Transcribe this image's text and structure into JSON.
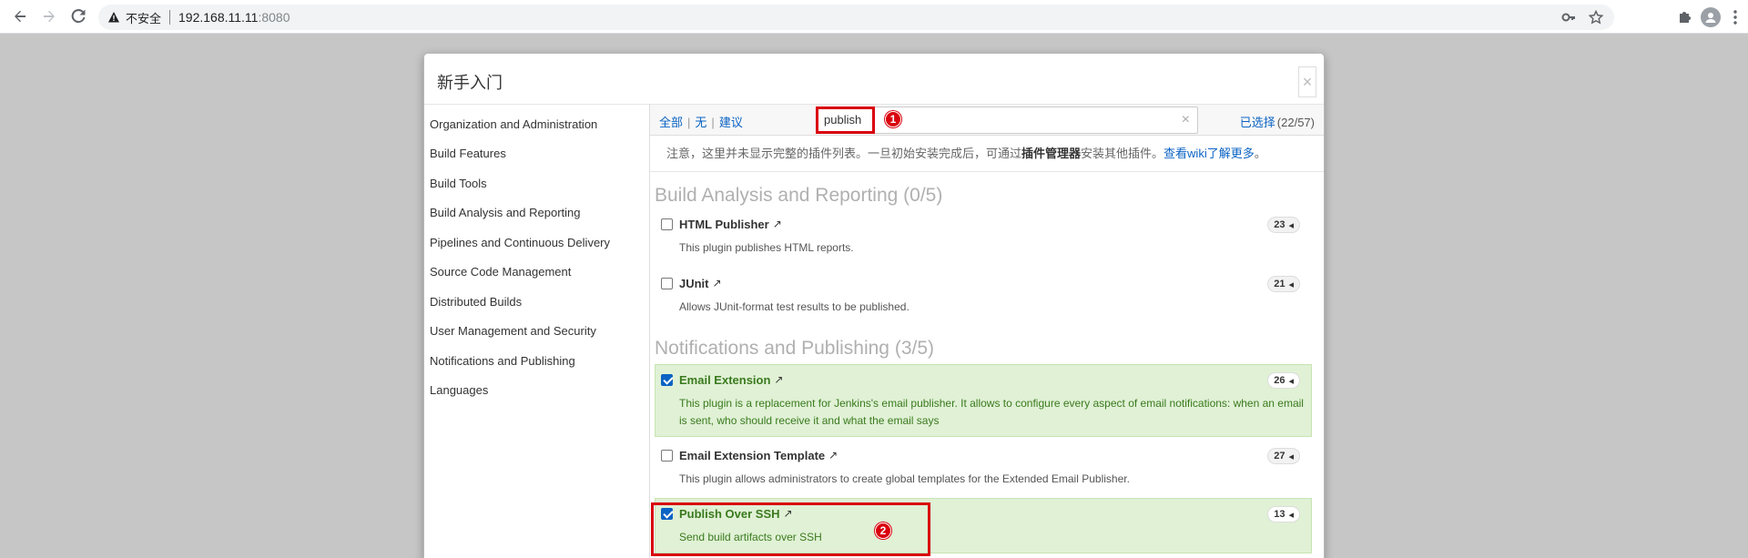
{
  "browser": {
    "security_label": "不安全",
    "host": "192.168.11.11",
    "port": ":8080"
  },
  "modal": {
    "title": "新手入门",
    "close_glyph": "×"
  },
  "sidebar": {
    "items": [
      {
        "label": "Organization and Administration"
      },
      {
        "label": "Build Features"
      },
      {
        "label": "Build Tools"
      },
      {
        "label": "Build Analysis and Reporting"
      },
      {
        "label": "Pipelines and Continuous Delivery"
      },
      {
        "label": "Source Code Management"
      },
      {
        "label": "Distributed Builds"
      },
      {
        "label": "User Management and Security"
      },
      {
        "label": "Notifications and Publishing"
      },
      {
        "label": "Languages"
      }
    ]
  },
  "filter": {
    "all": "全部",
    "none": "无",
    "suggested": "建议",
    "search_value": "publish",
    "selected_label": "已选择",
    "selected_count": "(22/57)"
  },
  "note": {
    "text_before": "注意，这里并未显示完整的插件列表。一旦初始安装完成后，可通过",
    "bold": "插件管理器",
    "text_after": "安装其他插件。",
    "link": "查看wiki了解更多",
    "end": "。"
  },
  "categories": [
    {
      "title": "Build Analysis and Reporting (0/5)",
      "plugins": [
        {
          "name": "HTML Publisher",
          "deps": "23",
          "checked": false,
          "description": "This plugin publishes HTML reports."
        },
        {
          "name": "JUnit",
          "deps": "21",
          "checked": false,
          "description": "Allows JUnit-format test results to be published."
        }
      ]
    },
    {
      "title": "Notifications and Publishing (3/5)",
      "plugins": [
        {
          "name": "Email Extension",
          "deps": "26",
          "checked": true,
          "description": "This plugin is a replacement for Jenkins's email publisher. It allows to configure every aspect of email notifications: when an email is sent, who should receive it and what the email says"
        },
        {
          "name": "Email Extension Template",
          "deps": "27",
          "checked": false,
          "description": "This plugin allows administrators to create global templates for the Extended Email Publisher."
        },
        {
          "name": "Publish Over SSH",
          "deps": "13",
          "checked": true,
          "description": "Send build artifacts over SSH"
        }
      ]
    }
  ],
  "annotations": {
    "marker1": "1",
    "marker2": "2"
  },
  "colors": {
    "accent": "#0b63c4",
    "checked_bg": "#e0f1d5",
    "annotation_red": "#d9000d"
  }
}
